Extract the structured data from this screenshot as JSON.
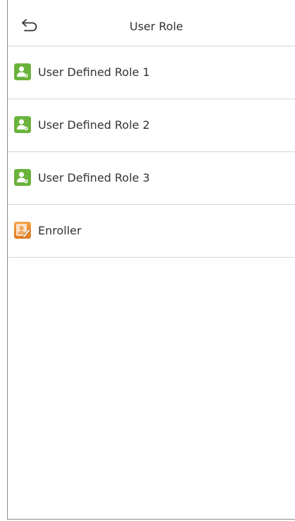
{
  "header": {
    "title": "User Role",
    "back_icon": "back-arrow-icon"
  },
  "roles": [
    {
      "label": "User Defined Role 1",
      "icon": "user-role-icon",
      "icon_color": "#6ab33c"
    },
    {
      "label": "User Defined Role 2",
      "icon": "user-role-icon",
      "icon_color": "#6ab33c"
    },
    {
      "label": "User Defined Role 3",
      "icon": "user-role-icon",
      "icon_color": "#6ab33c"
    },
    {
      "label": "Enroller",
      "icon": "enroller-icon",
      "icon_color": "#ee8c2c"
    }
  ],
  "colors": {
    "divider": "#d6d6d6",
    "text": "#333333",
    "role_green": "#6ab33c",
    "enroller_orange": "#ee8c2c"
  }
}
